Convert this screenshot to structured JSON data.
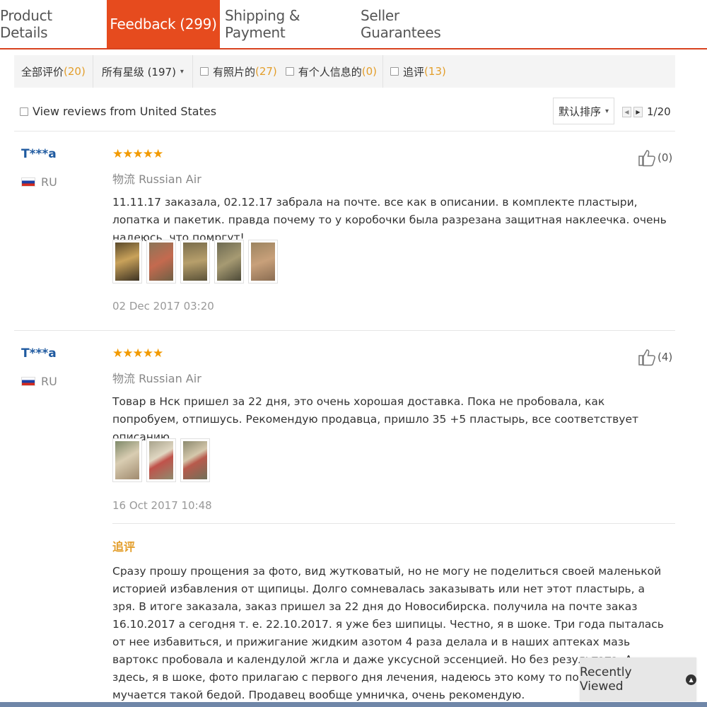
{
  "tabs": [
    {
      "label": "Product Details"
    },
    {
      "label": "Feedback (299)"
    },
    {
      "label": "Shipping & Payment"
    },
    {
      "label": "Seller Guarantees"
    }
  ],
  "filters": {
    "all_label": "全部评价",
    "all_count": "(20)",
    "ratings_label": "所有星级 (197)",
    "photos_label": "有照片的",
    "photos_count": "(27)",
    "personal_label": "有个人信息的",
    "personal_count": "(0)",
    "followup_label": "追评",
    "followup_count": "(13)"
  },
  "sort": {
    "us_reviews_label": "View reviews from United States",
    "sort_label": "默认排序",
    "page_indicator": "1/20"
  },
  "reviews": [
    {
      "user": "T***a",
      "country": "RU",
      "stars": "★★★★★",
      "logistics_label": "物流",
      "logistics": "Russian Air",
      "text": "11.11.17 заказала, 02.12.17 забрала на почте. все как в описании. в комплекте пластыри, лопатка и пакетик. правда почему то у коробочки была разрезана защитная наклеечка. очень надеюсь, что помргут!",
      "date": "02 Dec 2017 03:20",
      "likes": "(0)",
      "photo_count": 5
    },
    {
      "user": "T***a",
      "country": "RU",
      "stars": "★★★★★",
      "logistics_label": "物流",
      "logistics": "Russian Air",
      "text": "Товар в Нск пришел за 22 дня, это очень хорошая доставка. Пока не пробовала, как попробуем, отпишусь. Рекомендую продавца, пришло 35 +5 пластырь, все соответствует описанию.",
      "date": "16 Oct 2017 10:48",
      "likes": "(4)",
      "photo_count": 3,
      "followup_title": "追评",
      "followup_text": "Сразу прошу прощения за фото, вид жутковатый, но не могу не поделиться своей маленькой историей избавления от щипицы. Долго сомневалась заказывать или нет этот пластырь, а зря. В итоге заказала, заказ пришел за 22 дня до Новосибирска. получила на почте заказ 16.10.2017 а сегодня т. е. 22.10.2017. я уже без шипицы. Честно, я в шоке. Три года пыталась от нее избавиться, и прижигание жидким азотом 4 раза делала и в наших аптеках мазь вартокс пробовала и календулой жгла и даже уксусной эссенцией. Но без результата. А здесь, я в шоке, фото прилагаю с первого дня лечения, надеюсь это кому то поможет кто мучается такой бедой. Продавец вообще умничка, очень рекомендую."
    }
  ],
  "recently_viewed": "Recently Viewed",
  "colors": {
    "accent": "#e64b1e",
    "star": "#f29a00",
    "count": "#e39e2b",
    "username": "#1f5aa0"
  }
}
